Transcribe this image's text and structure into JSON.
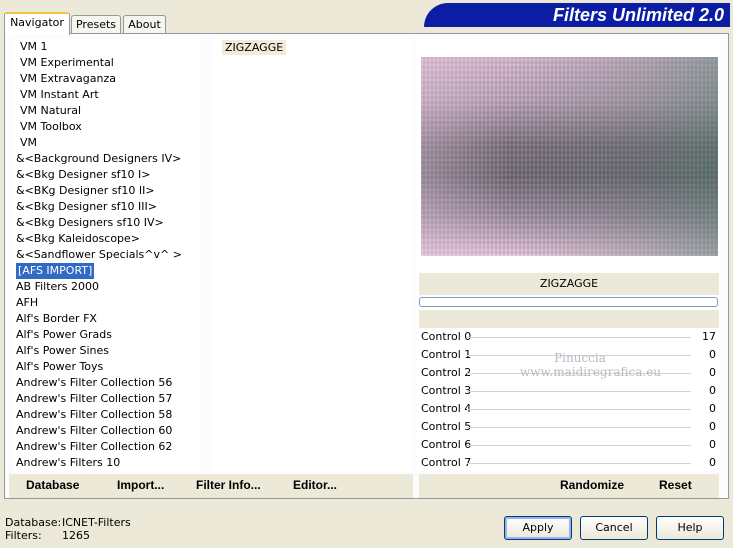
{
  "tabs": [
    {
      "label": "Navigator",
      "active": true
    },
    {
      "label": "Presets",
      "active": false
    },
    {
      "label": "About",
      "active": false
    }
  ],
  "banner_title": "Filters Unlimited 2.0",
  "category_list": [
    "VM 1",
    "VM Experimental",
    "VM Extravaganza",
    "VM Instant Art",
    "VM Natural",
    "VM Toolbox",
    "VM",
    "&<Background Designers IV>",
    "&<Bkg Designer sf10 I>",
    "&<BKg Designer sf10 II>",
    "&<Bkg Designer sf10 III>",
    "&<Bkg Designers sf10 IV>",
    "&<Bkg Kaleidoscope>",
    "&<Sandflower Specials^v^ >",
    "[AFS IMPORT]",
    "AB Filters 2000",
    "AFH",
    "Alf's Border FX",
    "Alf's Power Grads",
    "Alf's Power Sines",
    "Alf's Power Toys",
    "Andrew's Filter Collection 56",
    "Andrew's Filter Collection 57",
    "Andrew's Filter Collection 58",
    "Andrew's Filter Collection 60",
    "Andrew's Filter Collection 62",
    "Andrew's Filters 10"
  ],
  "selected_category_index": 14,
  "filter_list": [
    "ZIGZAGGE"
  ],
  "filter_name": "ZIGZAGGE",
  "controls": [
    {
      "label": "Control 0",
      "value": "17"
    },
    {
      "label": "Control 1",
      "value": "0"
    },
    {
      "label": "Control 2",
      "value": "0"
    },
    {
      "label": "Control 3",
      "value": "0"
    },
    {
      "label": "Control 4",
      "value": "0"
    },
    {
      "label": "Control 5",
      "value": "0"
    },
    {
      "label": "Control 6",
      "value": "0"
    },
    {
      "label": "Control 7",
      "value": "0"
    }
  ],
  "watermark": {
    "line1": "Pinuccia",
    "line2": "www.maidiregrafica.eu"
  },
  "left_buttons": {
    "database": "Database",
    "import": "Import...",
    "filter_info": "Filter Info...",
    "editor": "Editor..."
  },
  "right_buttons": {
    "randomize": "Randomize",
    "reset": "Reset"
  },
  "status": {
    "database_label": "Database:",
    "database_value": "ICNET-Filters",
    "filters_label": "Filters:",
    "filters_value": "1265"
  },
  "dialog_buttons": {
    "apply": "Apply",
    "cancel": "Cancel",
    "help": "Help"
  }
}
